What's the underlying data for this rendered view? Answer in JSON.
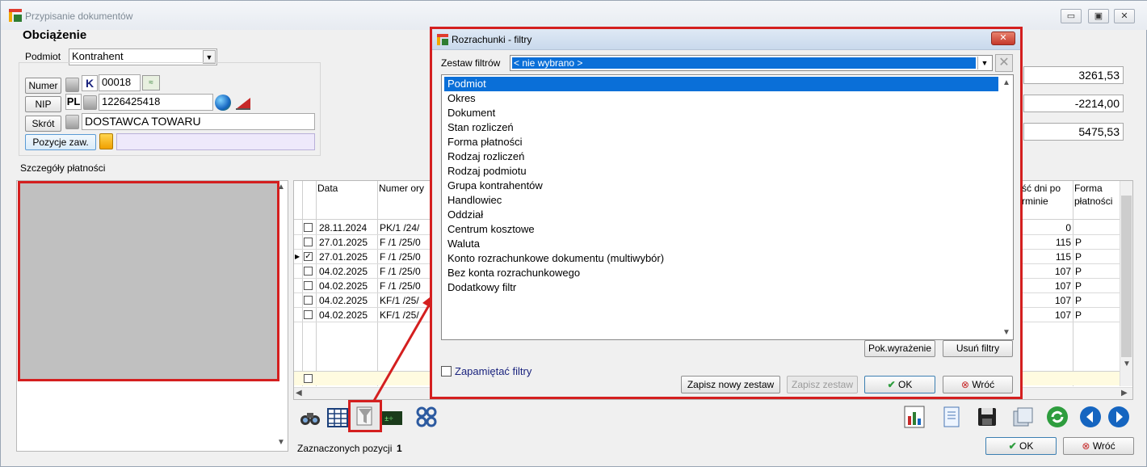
{
  "window": {
    "title": "Przypisanie dokumentów",
    "controls": {
      "minimize": "▭",
      "maximize": "▣",
      "close": "✕"
    }
  },
  "header": {
    "title": "Obciążenie"
  },
  "podmiot": {
    "label": "Podmiot",
    "value": "Kontrahent"
  },
  "contractor": {
    "numer_label": "Numer",
    "type_code": "K",
    "numer_value": "00018",
    "nip_label": "NIP",
    "nip_prefix": "PL",
    "nip_value": "1226425418",
    "skrot_label": "Skrót",
    "skrot_value": "DOSTAWCA TOWARU",
    "pozycje_label": "Pozycje zaw."
  },
  "details": {
    "label": "Szczegóły płatności"
  },
  "amounts": [
    "3261,53",
    "-2214,00",
    "5475,53"
  ],
  "table": {
    "headers": {
      "date": "Data",
      "number": "Numer ory",
      "days_a": "ść dni po",
      "days_b": "rminie",
      "form_a": "Forma",
      "form_b": "płatności"
    },
    "rows": [
      {
        "checked": false,
        "current": false,
        "date": "28.11.2024",
        "number": "PK/1  /24/",
        "days": "0",
        "form": ""
      },
      {
        "checked": false,
        "current": false,
        "date": "27.01.2025",
        "number": "F /1  /25/0",
        "days": "115",
        "form": "P"
      },
      {
        "checked": true,
        "current": true,
        "date": "27.01.2025",
        "number": "F /1  /25/0",
        "days": "115",
        "form": "P"
      },
      {
        "checked": false,
        "current": false,
        "date": "04.02.2025",
        "number": "F /1  /25/0",
        "days": "107",
        "form": "P"
      },
      {
        "checked": false,
        "current": false,
        "date": "04.02.2025",
        "number": "F /1  /25/0",
        "days": "107",
        "form": "P"
      },
      {
        "checked": false,
        "current": false,
        "date": "04.02.2025",
        "number": "KF/1  /25/",
        "days": "107",
        "form": "P"
      },
      {
        "checked": false,
        "current": false,
        "date": "04.02.2025",
        "number": "KF/1  /25/",
        "days": "107",
        "form": "P"
      }
    ]
  },
  "footer": {
    "selected_label": "Zaznaczonych pozycji",
    "selected_count": "1",
    "ok": "OK",
    "back": "Wróć"
  },
  "dialog": {
    "title": "Rozrachunki - filtry",
    "set_label": "Zestaw filtrów",
    "set_value": "< nie wybrano >",
    "filters": [
      "Podmiot",
      "Okres",
      "Dokument",
      "Stan rozliczeń",
      "Forma płatności",
      "Rodzaj rozliczeń",
      "Rodzaj podmiotu",
      "Grupa kontrahentów",
      "Handlowiec",
      "Oddział",
      "Centrum kosztowe",
      "Waluta",
      "Konto rozrachunkowe dokumentu (multiwybór)",
      "Bez konta rozrachunkowego",
      "Dodatkowy filtr"
    ],
    "selected_index": 0,
    "show_expr": "Pok.wyrażenie",
    "remove_filters": "Usuń filtry",
    "remember": "Zapamiętać filtry",
    "save_new": "Zapisz nowy zestaw",
    "save_set": "Zapisz zestaw",
    "ok": "OK",
    "back": "Wróć"
  },
  "colors": {
    "accent": "#0a6fd8",
    "highlight": "#d41f1f"
  }
}
